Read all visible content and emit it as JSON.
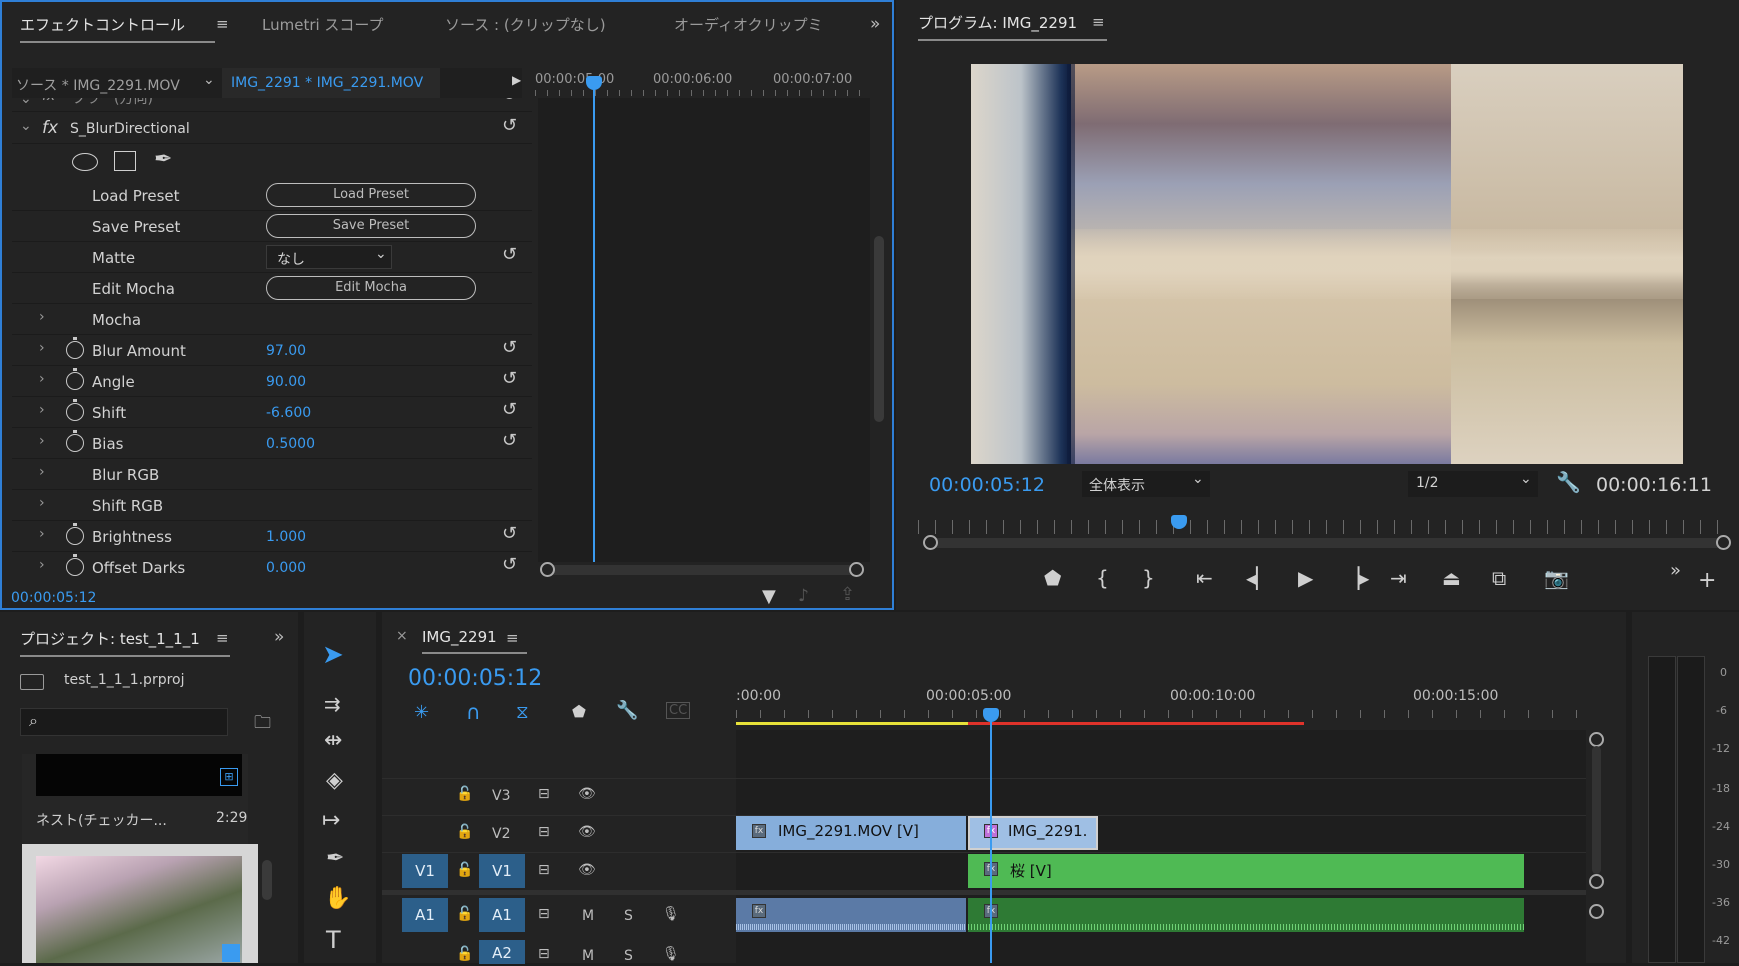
{
  "effect_controls": {
    "tab_effect_controls": "エフェクトコントロール",
    "tab_lumetri": "Lumetri スコープ",
    "tab_source": "ソース : (クリップなし)",
    "tab_audio_mixer": "オーディオクリップミ",
    "source_label": "ソース * IMG_2291.MOV",
    "sequence_clip": "IMG_2291 * IMG_2291.MOV",
    "fx_partial": "ブラー(方向)",
    "effect_name": "S_BlurDirectional",
    "load_preset_label": "Load Preset",
    "load_preset_btn": "Load Preset",
    "save_preset_label": "Save Preset",
    "save_preset_btn": "Save Preset",
    "matte_label": "Matte",
    "matte_value": "なし",
    "edit_mocha_label": "Edit Mocha",
    "edit_mocha_btn": "Edit Mocha",
    "mocha_label": "Mocha",
    "params": [
      {
        "label": "Blur Amount",
        "value": "97.00"
      },
      {
        "label": "Angle",
        "value": "90.00"
      },
      {
        "label": "Shift",
        "value": "-6.600"
      },
      {
        "label": "Bias",
        "value": "0.5000"
      },
      {
        "label": "Blur RGB",
        "value": ""
      },
      {
        "label": "Shift RGB",
        "value": ""
      },
      {
        "label": "Brightness",
        "value": "1.000"
      },
      {
        "label": "Offset Darks",
        "value": "0.000"
      }
    ],
    "ruler": [
      "00:00:05:00",
      "00:00:06:00",
      "00:00:07:00"
    ],
    "timecode": "00:00:05:12"
  },
  "program": {
    "title": "プログラム: IMG_2291",
    "timecode": "00:00:05:12",
    "zoom": "全体表示",
    "resolution": "1/2",
    "duration": "00:00:16:11"
  },
  "project": {
    "title": "プロジェクト: test_1_1_1",
    "file": "test_1_1_1.prproj",
    "item_name": "ネスト(チェッカー...",
    "item_duration": "2:29"
  },
  "timeline": {
    "title": "IMG_2291",
    "timecode": "00:00:05:12",
    "ruler": [
      ":00:00",
      "00:00:05:00",
      "00:00:10:00",
      "00:00:15:00"
    ],
    "tracks": {
      "v3": "V3",
      "v2": "V2",
      "v1_src": "V1",
      "v1": "V1",
      "a1_src": "A1",
      "a1": "A1",
      "a2": "A2",
      "m": "M",
      "s": "S"
    },
    "clips": {
      "v2_a": "IMG_2291.MOV [V]",
      "v2_b": "IMG_2291.",
      "v1_b": "桜 [V]"
    }
  },
  "meter": {
    "ticks": [
      "0",
      "-6",
      "-12",
      "-18",
      "-24",
      "-30",
      "-36",
      "-42"
    ]
  },
  "colors": {
    "accent": "#3a9bf0",
    "clip_blue": "#86aedb",
    "clip_green": "#4fba54",
    "workarea_yellow": "#e8e23a",
    "render_red": "#e0332b"
  }
}
